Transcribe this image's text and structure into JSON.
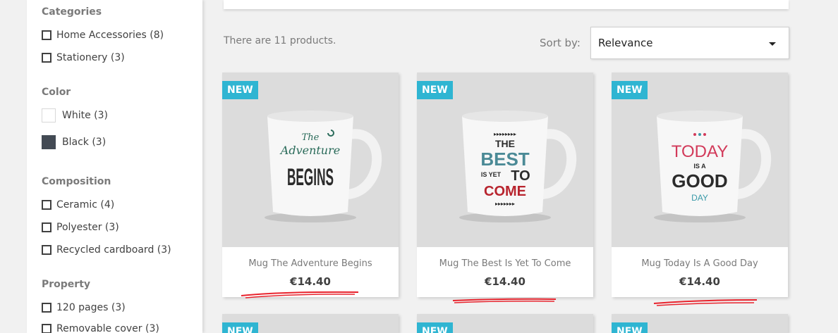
{
  "sidebar": {
    "categories": {
      "title": "Categories",
      "items": [
        {
          "label": "Home Accessories (8)"
        },
        {
          "label": "Stationery (3)"
        }
      ]
    },
    "color": {
      "title": "Color",
      "items": [
        {
          "label": "White (3)",
          "hex": "#ffffff"
        },
        {
          "label": "Black (3)",
          "hex": "#434a54"
        }
      ]
    },
    "composition": {
      "title": "Composition",
      "items": [
        {
          "label": "Ceramic (4)"
        },
        {
          "label": "Polyester (3)"
        },
        {
          "label": "Recycled cardboard (3)"
        }
      ]
    },
    "property": {
      "title": "Property",
      "items": [
        {
          "label": "120 pages (3)"
        },
        {
          "label": "Removable cover (3)"
        }
      ]
    }
  },
  "listing": {
    "count_text": "There are 11 products.",
    "sort_label": "Sort by:",
    "sort_value": "Relevance"
  },
  "products": [
    {
      "badge": "NEW",
      "name": "Mug The Adventure Begins",
      "price": "€14.40",
      "mug_lines": [
        "The",
        "Adventure",
        "BEGINS"
      ]
    },
    {
      "badge": "NEW",
      "name": "Mug The Best Is Yet To Come",
      "price": "€14.40",
      "mug_lines": [
        "THE",
        "BEST",
        "IS YET",
        "TO",
        "COME"
      ]
    },
    {
      "badge": "NEW",
      "name": "Mug Today Is A Good Day",
      "price": "€14.40",
      "mug_lines": [
        "TODAY",
        "IS A",
        "GOOD",
        "DAY"
      ]
    },
    {
      "badge": "NEW"
    },
    {
      "badge": "NEW"
    },
    {
      "badge": "NEW"
    }
  ],
  "colors": {
    "accent": "#2fb5d2",
    "annotation": "#e8232d"
  }
}
